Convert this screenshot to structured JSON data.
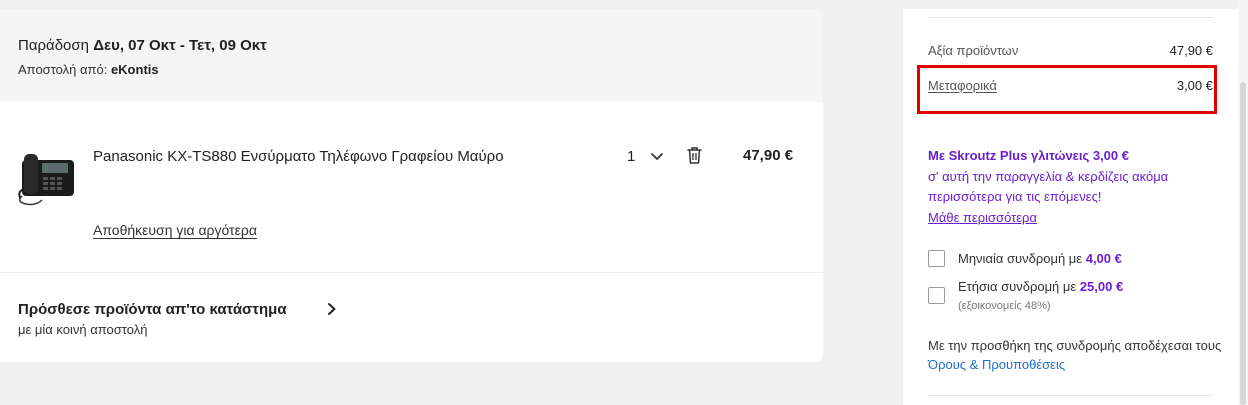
{
  "delivery": {
    "prefix": "Παράδοση",
    "dates": "Δευ, 07 Οκτ - Τετ, 09 Οκτ",
    "shipper_prefix": "Αποστολή από:",
    "shipper": "eKontis"
  },
  "product": {
    "title": "Panasonic KX-TS880 Ενσύρματο Τηλέφωνο Γραφείου Μαύρο",
    "quantity": "1",
    "price": "47,90 €",
    "save_later": "Αποθήκευση για αργότερα",
    "image_icon": "desk-phone-image"
  },
  "add_more": {
    "title": "Πρόσθεσε προϊόντα απ'το κατάστημα",
    "subtitle": "με μία κοινή αποστολή"
  },
  "summary": {
    "items_label": "Αξία προϊόντων",
    "items_value": "47,90 €",
    "shipping_label": "Μεταφορικά",
    "shipping_value": "3,00 €",
    "plus_bold": "Με Skroutz Plus γλιτώνεις 3,00 €",
    "plus_text": "σ' αυτή την παραγγελία & κερδίζεις ακόμα περισσότερα για τις επόμενες!",
    "plus_link": "Μάθε περισσότερα",
    "monthly_prefix": "Μηνιαία συνδρομή με",
    "monthly_amount": "4,00 €",
    "yearly_prefix": "Ετήσια συνδρομή με",
    "yearly_amount": "25,00 €",
    "yearly_note": "(εξοικονομείς 48%)",
    "terms_text": "Με την προσθήκη της συνδρομής αποδέχεσαι τους",
    "terms_link": "Όρους & Προυποθέσεις"
  },
  "colors": {
    "accent_purple": "#6a1fd1",
    "highlight_red": "#e00000",
    "link_blue": "#1f6fd1"
  }
}
